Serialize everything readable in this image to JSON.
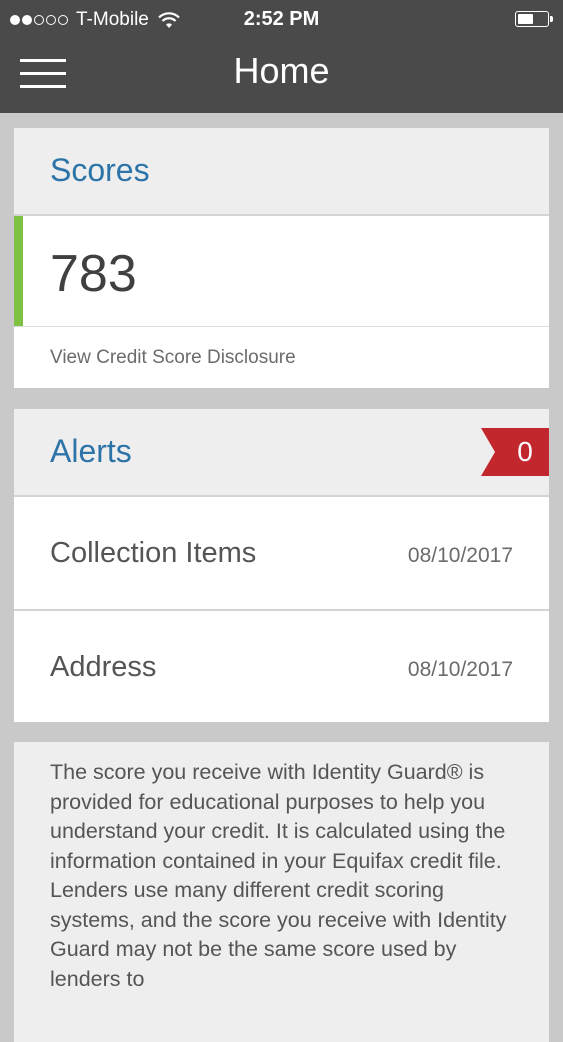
{
  "status_bar": {
    "carrier": "T-Mobile",
    "signal_bars_filled": 2,
    "signal_bars_total": 5,
    "time": "2:52 PM",
    "battery_level": 0.55
  },
  "nav": {
    "title": "Home",
    "menu_icon": "hamburger-menu-icon"
  },
  "scores": {
    "heading": "Scores",
    "value": "783",
    "disclosure_link": "View Credit Score Disclosure"
  },
  "alerts": {
    "heading": "Alerts",
    "count": "0",
    "items": [
      {
        "label": "Collection Items",
        "date": "08/10/2017"
      },
      {
        "label": "Address",
        "date": "08/10/2017"
      }
    ]
  },
  "info": {
    "text": "The score you receive with Identity Guard® is provided for educational purposes to help you understand your credit. It is calculated using the information contained in your Equifax credit file. Lenders use many different credit scoring systems, and the score you receive with Identity Guard may not be the same score used by lenders to"
  },
  "colors": {
    "top_bar": "#4a4a4b",
    "heading_blue": "#2c74a8",
    "score_accent_green": "#7dc242",
    "alert_badge_red": "#c1272d",
    "page_background": "#c9c9ca"
  }
}
